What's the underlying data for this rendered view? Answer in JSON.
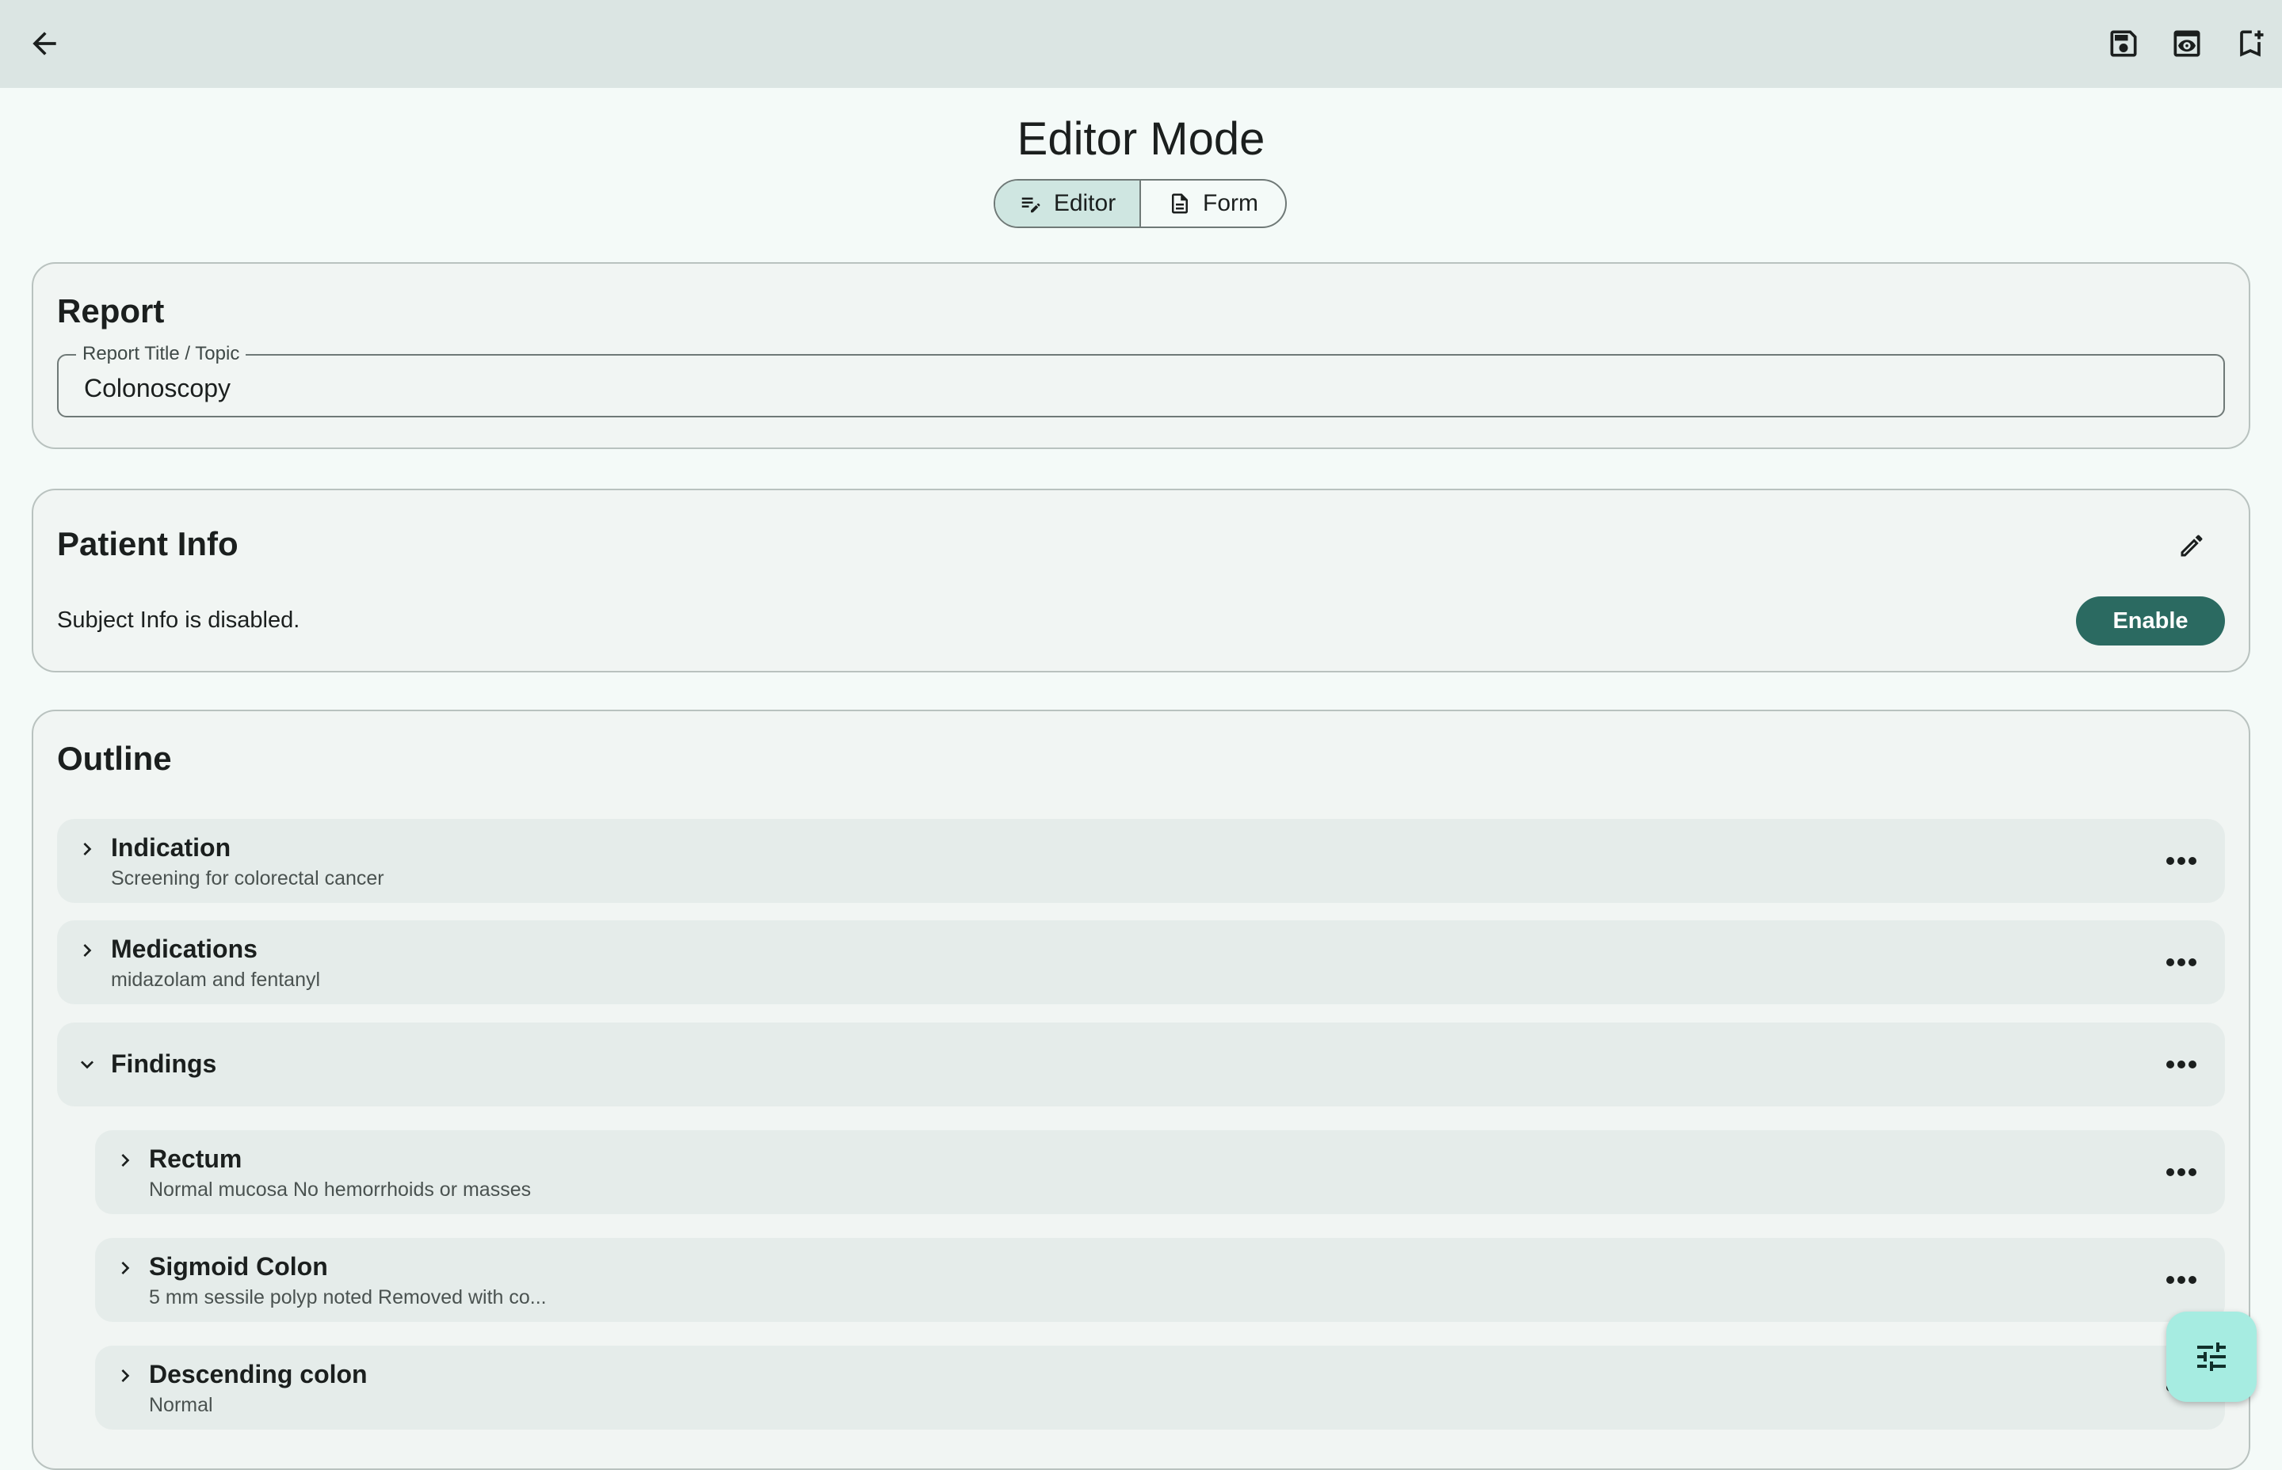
{
  "header": {
    "back_icon": "arrow-left-icon",
    "actions": [
      "save-icon",
      "preview-icon",
      "bookmark-add-icon"
    ]
  },
  "page": {
    "title": "Editor Mode"
  },
  "mode_switch": {
    "editor_label": "Editor",
    "form_label": "Form",
    "selected": "Editor"
  },
  "report": {
    "title": "Report",
    "field_label": "Report Title / Topic",
    "field_value": "Colonoscopy"
  },
  "patient_info": {
    "title": "Patient Info",
    "status_text": "Subject Info is disabled.",
    "enable_label": "Enable"
  },
  "outline": {
    "title": "Outline",
    "items": [
      {
        "title": "Indication",
        "subtitle": "Screening for colorectal cancer",
        "expanded": false
      },
      {
        "title": "Medications",
        "subtitle": "midazolam and fentanyl",
        "expanded": false
      },
      {
        "title": "Findings",
        "subtitle": "",
        "expanded": true
      }
    ],
    "findings_children": [
      {
        "title": "Rectum",
        "subtitle": "Normal mucosa No hemorrhoids or masses"
      },
      {
        "title": "Sigmoid Colon",
        "subtitle": "5 mm sessile polyp noted Removed with co..."
      },
      {
        "title": "Descending colon",
        "subtitle": "Normal"
      }
    ]
  },
  "fab": {
    "icon": "tune-icon"
  },
  "colors": {
    "appbar": "#dbe5e3",
    "background": "#f4faf8",
    "primary": "#2b6a61",
    "fab": "#a6ece1",
    "segment_active": "#cfe6e1"
  }
}
